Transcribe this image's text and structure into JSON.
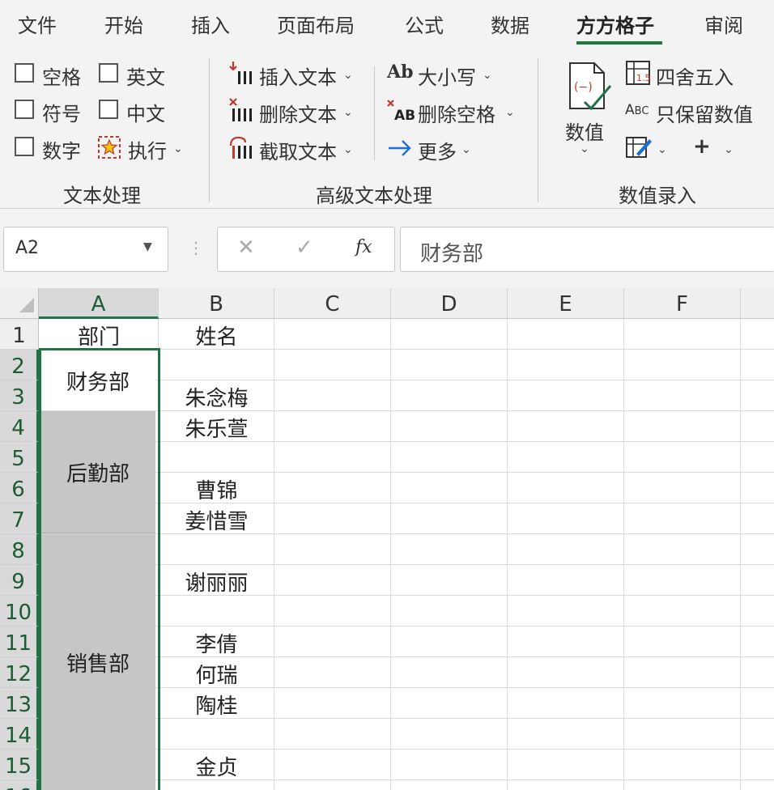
{
  "tabs": [
    "文件",
    "开始",
    "插入",
    "页面布局",
    "公式",
    "数据",
    "方方格子",
    "审阅"
  ],
  "active_tab": "方方格子",
  "ribbon": {
    "text_processing": {
      "checkboxes": [
        "空格",
        "英文",
        "符号",
        "中文",
        "数字"
      ],
      "execute": "执行",
      "group_label": "文本处理"
    },
    "advanced_text": {
      "insert_text": "插入文本",
      "delete_text": "删除文本",
      "extract_text": "截取文本",
      "case": "大小写",
      "delete_space": "删除空格",
      "more": "更多",
      "group_label": "高级文本处理"
    },
    "number_entry": {
      "value": "数值",
      "round": "四舍五入",
      "keep_values": "只保留数值",
      "group_label": "数值录入"
    }
  },
  "formula_bar": {
    "name_box": "A2",
    "fx": "fx",
    "formula": "财务部"
  },
  "sheet": {
    "columns": [
      "A",
      "B",
      "C",
      "D",
      "E",
      "F"
    ],
    "rows": [
      "1",
      "2",
      "3",
      "4",
      "5",
      "6",
      "7",
      "8",
      "9",
      "10",
      "11",
      "12",
      "13",
      "14",
      "15",
      "16"
    ],
    "header": {
      "a1": "部门",
      "b1": "姓名"
    },
    "departments": [
      "财务部",
      "后勤部",
      "销售部"
    ],
    "names": [
      "朱念梅",
      "朱乐萱",
      "曹锦",
      "姜惜雪",
      "谢丽丽",
      "李倩",
      "何瑞",
      "陶桂",
      "金贞"
    ]
  },
  "colors": {
    "accent": "#217346",
    "merged_gray": "#c6c6c6",
    "ribbon_bg": "#f3f3f3"
  }
}
